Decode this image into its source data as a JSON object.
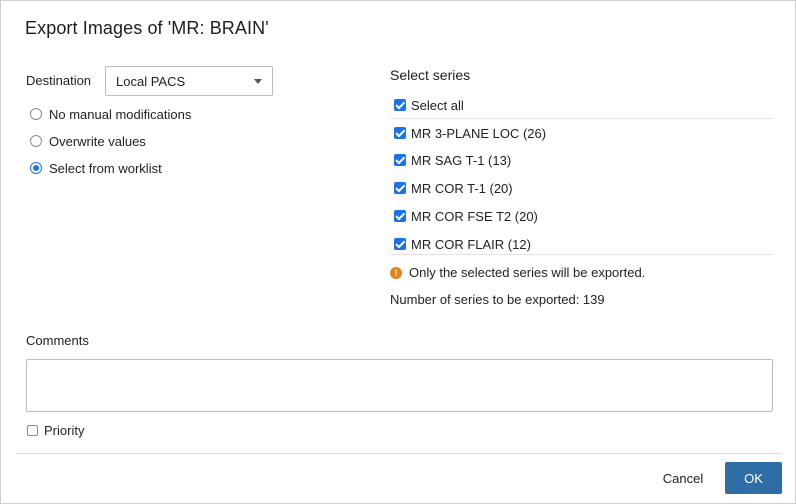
{
  "dialog": {
    "title": "Export Images of 'MR: BRAIN'"
  },
  "destination": {
    "label": "Destination",
    "selected": "Local PACS"
  },
  "modes": [
    {
      "label": "No manual modifications",
      "checked": false
    },
    {
      "label": "Overwrite values",
      "checked": false
    },
    {
      "label": "Select from worklist",
      "checked": true
    }
  ],
  "series_panel": {
    "title": "Select series",
    "select_all_label": "Select all",
    "select_all_checked": true,
    "items": [
      {
        "label": "MR 3-PLANE LOC (26)",
        "checked": true
      },
      {
        "label": "MR SAG T-1 (13)",
        "checked": true
      },
      {
        "label": "MR COR T-1 (20)",
        "checked": true
      },
      {
        "label": "MR COR FSE T2 (20)",
        "checked": true
      },
      {
        "label": "MR COR FLAIR (12)",
        "checked": true
      }
    ],
    "warning_text": "Only the selected series will be exported.",
    "count_text": "Number of series to be exported: 139"
  },
  "comments": {
    "label": "Comments",
    "value": "",
    "placeholder": ""
  },
  "priority": {
    "label": "Priority",
    "checked": false
  },
  "footer": {
    "cancel_label": "Cancel",
    "ok_label": "OK"
  },
  "colors": {
    "accent": "#1a73e8",
    "primary_button": "#2f6ea4",
    "warning": "#e8821e"
  },
  "icons": {
    "select_caret": "chevron-down-icon",
    "warning": "warning-icon"
  }
}
